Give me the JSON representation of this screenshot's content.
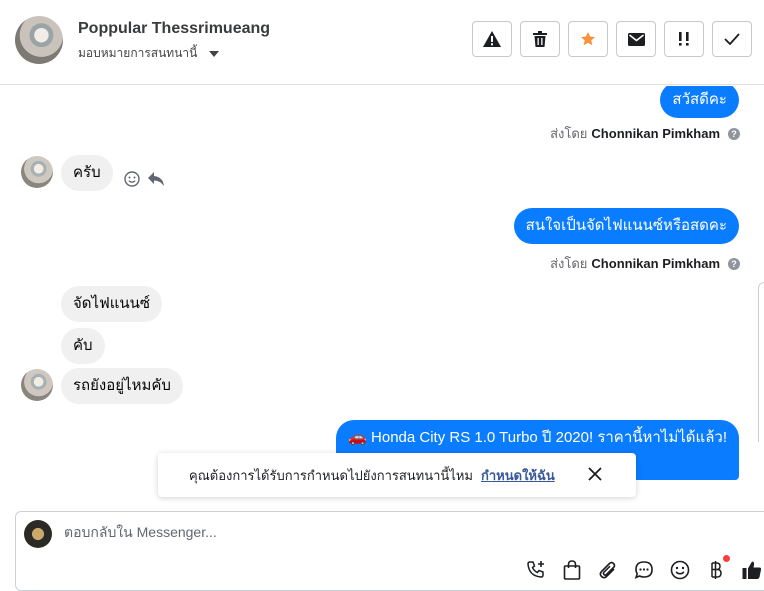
{
  "header": {
    "contact_name": "Poppular Thessrimueang",
    "assign_label": "มอบหมายการสนทนานี้",
    "actions": [
      {
        "name": "mark-spam-button",
        "icon": "warning-icon"
      },
      {
        "name": "delete-button",
        "icon": "trash-icon"
      },
      {
        "name": "star-button",
        "icon": "star-icon"
      },
      {
        "name": "mark-unread-button",
        "icon": "envelope-icon"
      },
      {
        "name": "follow-up-button",
        "icon": "exclamation-icon"
      },
      {
        "name": "mark-done-button",
        "icon": "check-icon"
      }
    ],
    "star_color": "#f7923a"
  },
  "messages": {
    "m1": "สวัสดีคะ",
    "m1_sent_by_prefix": "ส่งโดย",
    "m1_sent_by_name": "Chonnikan Pimkham",
    "m2": "ครับ",
    "m3": "สนใจเป็นจัดไฟแนนซ์หรือสดคะ",
    "m3_sent_by_prefix": "ส่งโดย",
    "m3_sent_by_name": "Chonnikan Pimkham",
    "m4": "จัดไฟแนนซ์",
    "m5": "คับ",
    "m6": "รถยังอยู่ไหมคับ",
    "m7": "🚗 Honda City RS 1.0 Turbo ปี 2020! ราคานี้หาไม่ได้แล้ว!"
  },
  "toast": {
    "text": "คุณต้องการได้รับการกำหนดไปยังการสนทนานี้ไหม",
    "link": "กำหนดให้ฉัน"
  },
  "composer": {
    "placeholder": "ตอบกลับใน Messenger...",
    "tools": [
      "call-add-icon",
      "shopping-bag-icon",
      "attachment-icon",
      "saved-reply-icon",
      "emoji-icon",
      "baht-icon",
      "like-icon"
    ]
  },
  "colors": {
    "outgoing": "#0a7cff",
    "incoming": "#f0f0f0",
    "link": "#385898"
  }
}
